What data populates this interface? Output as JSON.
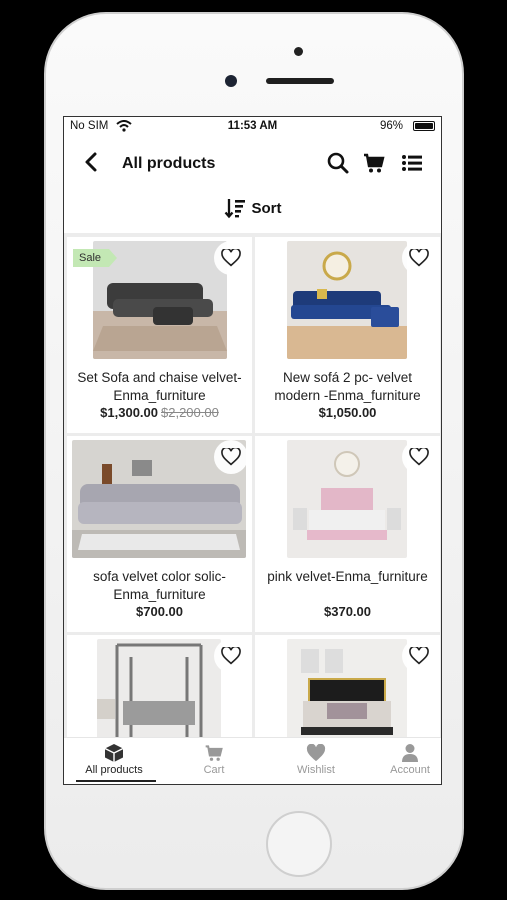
{
  "status": {
    "carrier": "No SIM",
    "time": "11:53 AM",
    "battery": "96%"
  },
  "header": {
    "title": "All products"
  },
  "sort": {
    "label": "Sort"
  },
  "products": [
    {
      "name": "Set Sofa and chaise velvet-Enma_furniture",
      "price": "$1,300.00",
      "old_price": "$2,200.00",
      "badge": "Sale"
    },
    {
      "name": "New sofá 2 pc- velvet modern -Enma_furniture",
      "price": "$1,050.00"
    },
    {
      "name": "sofa velvet color solic-Enma_furniture",
      "price": "$700.00"
    },
    {
      "name": "pink velvet-Enma_furniture",
      "price": "$370.00"
    }
  ],
  "tabs": [
    {
      "label": "All products",
      "icon": "box-icon"
    },
    {
      "label": "Cart",
      "icon": "cart-icon"
    },
    {
      "label": "Wishlist",
      "icon": "heart-icon"
    },
    {
      "label": "Account",
      "icon": "user-icon"
    }
  ],
  "colors": {
    "sale_badge": "#c3e8b4",
    "accent": "#111111"
  }
}
